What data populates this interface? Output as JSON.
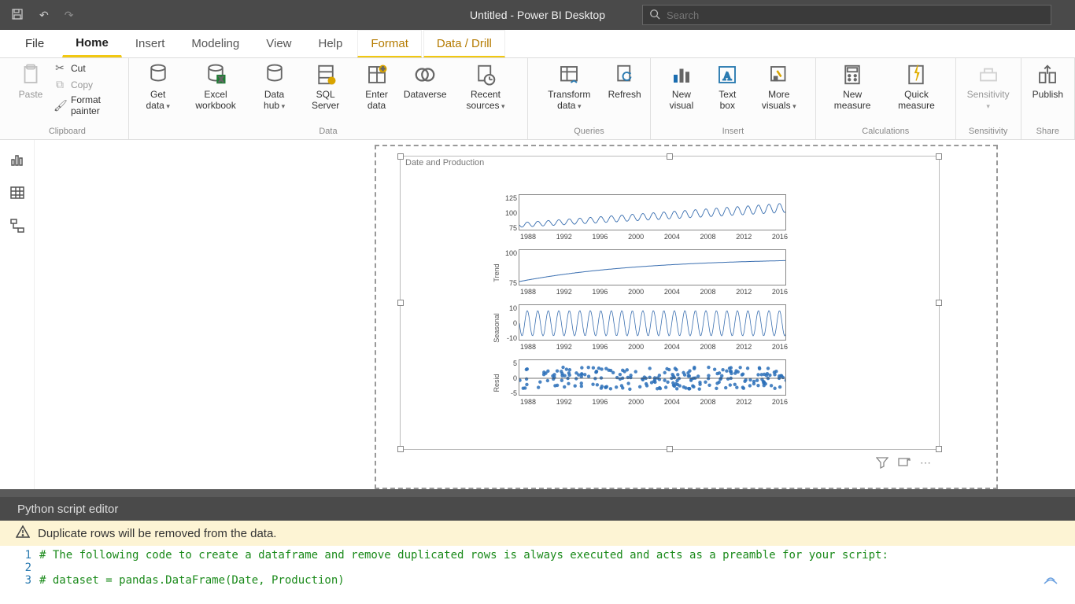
{
  "titlebar": {
    "title": "Untitled - Power BI Desktop",
    "search_placeholder": "Search"
  },
  "tabs": {
    "file": "File",
    "home": "Home",
    "insert": "Insert",
    "modeling": "Modeling",
    "view": "View",
    "help": "Help",
    "format": "Format",
    "datadrill": "Data / Drill"
  },
  "ribbon": {
    "paste": "Paste",
    "cut": "Cut",
    "copy": "Copy",
    "fmt": "Format painter",
    "getdata": "Get data",
    "excel": "Excel workbook",
    "datahub": "Data hub",
    "sql": "SQL Server",
    "enter": "Enter data",
    "dataverse": "Dataverse",
    "recent": "Recent sources",
    "transform": "Transform data",
    "refresh": "Refresh",
    "newvis": "New visual",
    "textbox": "Text box",
    "morevis": "More visuals",
    "newmeas": "New measure",
    "quickmeas": "Quick measure",
    "sensitivity": "Sensitivity",
    "publish": "Publish",
    "g_clip": "Clipboard",
    "g_data": "Data",
    "g_queries": "Queries",
    "g_insert": "Insert",
    "g_calc": "Calculations",
    "g_sens": "Sensitivity",
    "g_share": "Share"
  },
  "visual": {
    "title": "Date and Production"
  },
  "chart_data": [
    {
      "type": "line",
      "ylabel": "",
      "ylim": [
        70,
        130
      ],
      "yticks": [
        125,
        100,
        75
      ],
      "xticks": [
        "1988",
        "1992",
        "1996",
        "2000",
        "2004",
        "2008",
        "2012",
        "2016"
      ],
      "x_range": [
        1986,
        2018
      ],
      "desc": "Observed series rising from ~70 in 1986 to ~110 by 2016 with strong annual seasonality"
    },
    {
      "type": "line",
      "ylabel": "Trend",
      "ylim": [
        65,
        115
      ],
      "yticks": [
        100,
        75
      ],
      "xticks": [
        "1988",
        "1992",
        "1996",
        "2000",
        "2004",
        "2008",
        "2012",
        "2016"
      ],
      "x_range": [
        1986,
        2018
      ],
      "desc": "Smooth trend ~68 (1986) to ~108 (2010+) flattening"
    },
    {
      "type": "line",
      "ylabel": "Seasonal",
      "ylim": [
        -14,
        14
      ],
      "yticks": [
        10,
        0,
        -10
      ],
      "xticks": [
        "1988",
        "1992",
        "1996",
        "2000",
        "2004",
        "2008",
        "2012",
        "2016"
      ],
      "x_range": [
        1986,
        2018
      ],
      "desc": "Annual seasonal component amplitude ±10, dense oscillation"
    },
    {
      "type": "scatter",
      "ylabel": "Resid",
      "ylim": [
        -8,
        8
      ],
      "yticks": [
        5,
        0,
        -5
      ],
      "xticks": [
        "1988",
        "1992",
        "1996",
        "2000",
        "2004",
        "2008",
        "2012",
        "2016"
      ],
      "x_range": [
        1986,
        2018
      ],
      "desc": "Residuals scattered mostly between -5 and 5"
    }
  ],
  "editor": {
    "title": "Python script editor",
    "warning": "Duplicate rows will be removed from the data.",
    "lines": [
      "# The following code to create a dataframe and remove duplicated rows is always executed and acts as a preamble for your script:",
      "",
      "# dataset = pandas.DataFrame(Date, Production)"
    ]
  }
}
